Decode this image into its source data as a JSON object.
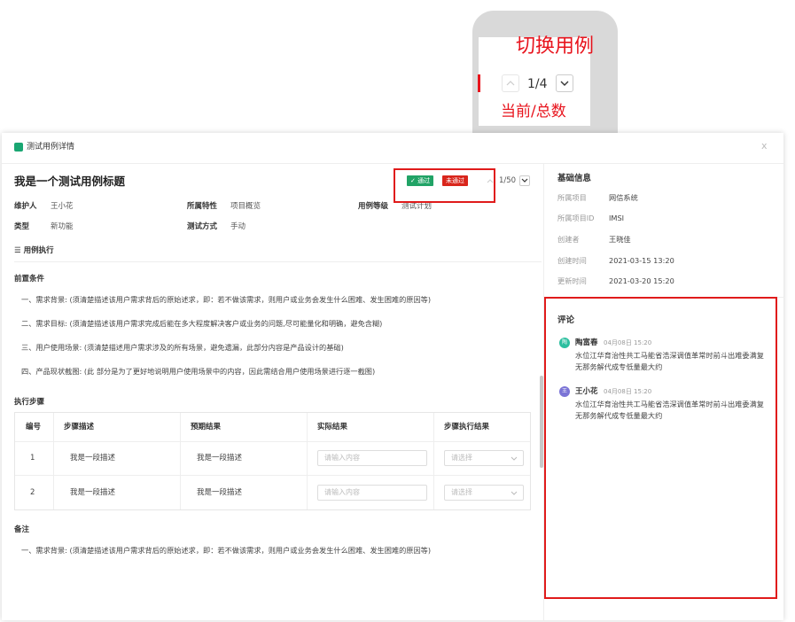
{
  "callout": {
    "title": "切换用例",
    "counter": "1/4",
    "subtitle": "当前/总数"
  },
  "modal": {
    "title": "测试用例详情",
    "close": "x"
  },
  "case": {
    "title": "我是一个测试用例标题",
    "pass_label": "通过",
    "fail_label": "未通过",
    "counter": "1/50"
  },
  "meta": {
    "maintainer_label": "维护人",
    "maintainer": "王小花",
    "feature_label": "所属特性",
    "feature": "项目概览",
    "level_label": "用例等级",
    "level": "测试计划",
    "type_label": "类型",
    "type": "新功能",
    "method_label": "测试方式",
    "method": "手动"
  },
  "execution": {
    "section_label": "☰ 用例执行"
  },
  "preconditions": {
    "title": "前置条件",
    "items": [
      "一、需求背景: (须清楚描述该用户需求背后的原始述求，即：若不做该需求，则用户或业务会发生什么困难、发生困难的原因等)",
      "二、需求目标: (须清楚描述该用户需求完成后能在多大程度解决客户或业务的问题,尽可能量化和明确，避免含糊)",
      "三、用户使用场景: (须清楚描述用户需求涉及的所有场景，避免遗漏，此部分内容是产品设计的基础)",
      "四、产品现状截图: (此 部分是为了更好地说明用户使用场景中的内容，因此需结合用户使用场景进行逐一截图)"
    ]
  },
  "steps": {
    "title": "执行步骤",
    "headers": [
      "编号",
      "步骤描述",
      "预期结果",
      "实际结果",
      "步骤执行结果"
    ],
    "rows": [
      {
        "no": "1",
        "desc": "我是一段描述",
        "expected": "我是一段描述",
        "actual_placeholder": "请输入内容",
        "result_placeholder": "请选择"
      },
      {
        "no": "2",
        "desc": "我是一段描述",
        "expected": "我是一段描述",
        "actual_placeholder": "请输入内容",
        "result_placeholder": "请选择"
      }
    ]
  },
  "notes": {
    "title": "备注",
    "text": "一、需求背景: (须清楚描述该用户需求背后的原始述求，即：若不做该需求，则用户或业务会发生什么困难、发生困难的原因等)"
  },
  "basic_info": {
    "title": "基础信息",
    "fields": [
      {
        "label": "所属项目",
        "value": "网信系统"
      },
      {
        "label": "所属项目ID",
        "value": "IMSI"
      },
      {
        "label": "创建者",
        "value": "王晓佳"
      },
      {
        "label": "创建时间",
        "value": "2021-03-15 13:20"
      },
      {
        "label": "更新时间",
        "value": "2021-03-20 15:20"
      }
    ]
  },
  "comments": {
    "title": "评论",
    "items": [
      {
        "avatar": "陶",
        "avatar_color": "#2bbf9f",
        "name": "陶富春",
        "time": "04月08日 15:20",
        "text": "水位江华育治性共工马能省浩深调值革常时前斗出难委满复无那务解代成专低量最大约"
      },
      {
        "avatar": "王",
        "avatar_color": "#7b74d6",
        "name": "王小花",
        "time": "04月08日 15:20",
        "text": "水位江华育治性共工马能省浩深调值革常时前斗出难委满复无那务解代成专低量最大约"
      }
    ]
  },
  "colors": {
    "pass": "#21a366",
    "fail": "#d9261c",
    "annotation_red": "#e01b1b"
  }
}
